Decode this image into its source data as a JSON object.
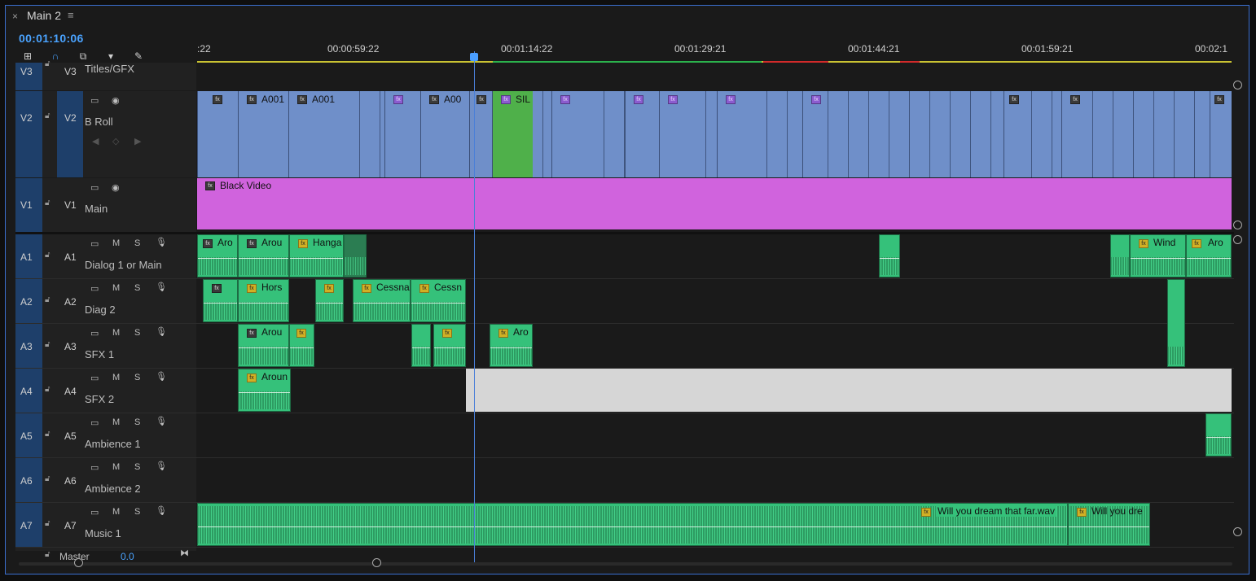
{
  "panel": {
    "close": "×",
    "title": "Main 2",
    "menu": "≡",
    "timecode": "00:01:10:06"
  },
  "ruler": {
    "labels": [
      ":22",
      "00:00:59:22",
      "00:01:14:22",
      "00:01:29:21",
      "00:01:44:21",
      "00:01:59:21",
      "00:02:1"
    ]
  },
  "tracks": {
    "v3": {
      "rail": "V3",
      "target": "V3",
      "name": "Titles/GFX"
    },
    "v2": {
      "rail": "V2",
      "target": "V2",
      "name": "B Roll"
    },
    "v1": {
      "rail": "V1",
      "target": "V1",
      "name": "Main"
    },
    "a1": {
      "rail": "A1",
      "target": "A1",
      "name": "Dialog 1 or Main"
    },
    "a2": {
      "rail": "A2",
      "target": "A2",
      "name": "Diag 2"
    },
    "a3": {
      "rail": "A3",
      "target": "A3",
      "name": "SFX 1"
    },
    "a4": {
      "rail": "A4",
      "target": "A4",
      "name": "SFX 2"
    },
    "a5": {
      "rail": "A5",
      "target": "A5",
      "name": "Ambience 1"
    },
    "a6": {
      "rail": "A6",
      "target": "A6",
      "name": "Ambience 2"
    },
    "a7": {
      "rail": "A7",
      "target": "A7",
      "name": "Music 1"
    },
    "master": {
      "name": "Master",
      "value": "0.0"
    }
  },
  "audio_buttons": {
    "m": "M",
    "s": "S"
  },
  "clips": {
    "v2_a": "A001",
    "v2_b": "A001",
    "v2_c": "A00",
    "v2_d": "SIL",
    "v1_black": "Black Video",
    "a1_1": "Aro",
    "a1_2": "Arou",
    "a1_3": "Hanga",
    "a1_4": "Wind",
    "a1_5": "Aro",
    "a2_1": "Hors",
    "a2_2": "Cessna",
    "a2_3": "Cessn",
    "a3_1": "Arou",
    "a3_2": "Aro",
    "a4_1": "Aroun",
    "a7_1": "Will you dream that far.wav",
    "a7_2": "Will you dre"
  },
  "colors": {
    "video_clip": "#6f8fc9",
    "selected_clip": "#4fb04a",
    "black_video": "#d063dd",
    "audio_clip": "#35c17a",
    "playhead": "#4a7fd8",
    "timecode": "#4aa3ff"
  }
}
